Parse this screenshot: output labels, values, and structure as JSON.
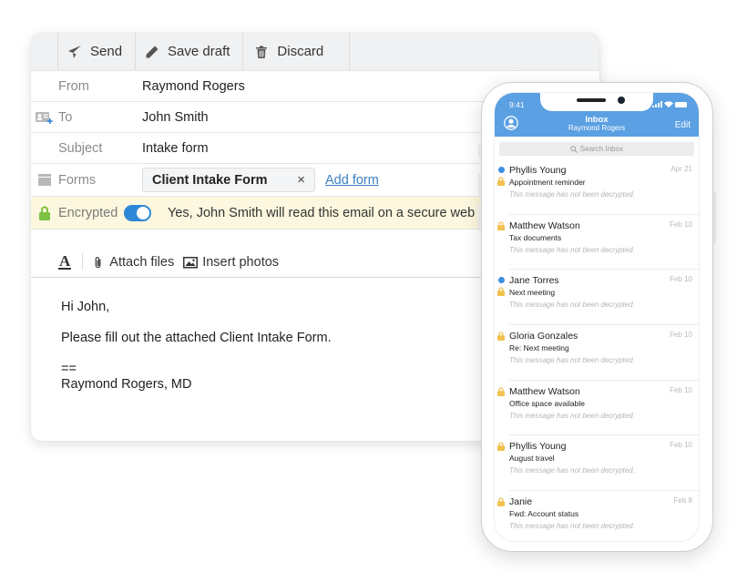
{
  "compose": {
    "toolbar": {
      "send": "Send",
      "save_draft": "Save draft",
      "discard": "Discard"
    },
    "fields": {
      "from_label": "From",
      "from_value": "Raymond Rogers",
      "to_label": "To",
      "to_value": "John Smith",
      "subject_label": "Subject",
      "subject_value": "Intake form",
      "forms_label": "Forms",
      "form_chip": "Client Intake Form",
      "form_chip_remove": "×",
      "add_form": "Add form"
    },
    "encryption": {
      "label": "Encrypted",
      "enabled": true,
      "message": "Yes, John Smith will read this email on a secure web page."
    },
    "format_bar": {
      "text_format": "A",
      "attach_files": "Attach files",
      "insert_photos": "Insert photos"
    },
    "body": {
      "greeting": "Hi John,",
      "line1": "Please fill out the attached Client Intake Form.",
      "sig_sep": "==",
      "signature": "Raymond Rogers, MD"
    },
    "colors": {
      "accent": "#2e87d6",
      "link": "#3b7fc4",
      "encrypted_bg": "#fcf7de",
      "lock_green": "#7dc242"
    }
  },
  "phone": {
    "status_time": "9:41",
    "header_title": "Inbox",
    "header_subtitle": "Raymond Rogers",
    "edit": "Edit",
    "search_placeholder": "Search Inbox",
    "header_color": "#5aa0e3",
    "messages": [
      {
        "sender": "Phyllis Young",
        "subject": "Appointment reminder",
        "preview": "This message has not been decrypted.",
        "date": "Apr 21",
        "unread": true
      },
      {
        "sender": "Matthew Watson",
        "subject": "Tax documents",
        "preview": "This message has not been decrypted.",
        "date": "Feb 10",
        "unread": false
      },
      {
        "sender": "Jane Torres",
        "subject": "Next meeting",
        "preview": "This message has not been decrypted.",
        "date": "Feb 10",
        "unread": true
      },
      {
        "sender": "Gloria Gonzales",
        "subject": "Re: Next meeting",
        "preview": "This message has not been decrypted.",
        "date": "Feb 10",
        "unread": false
      },
      {
        "sender": "Matthew Watson",
        "subject": "Office space available",
        "preview": "This message has not been decrypted.",
        "date": "Feb 10",
        "unread": false
      },
      {
        "sender": "Phyllis Young",
        "subject": "August travel",
        "preview": "This message has not been decrypted.",
        "date": "Feb 10",
        "unread": false
      },
      {
        "sender": "Janie",
        "subject": "Fwd: Account status",
        "preview": "This message has not been decrypted.",
        "date": "Feb 8",
        "unread": false
      }
    ]
  }
}
